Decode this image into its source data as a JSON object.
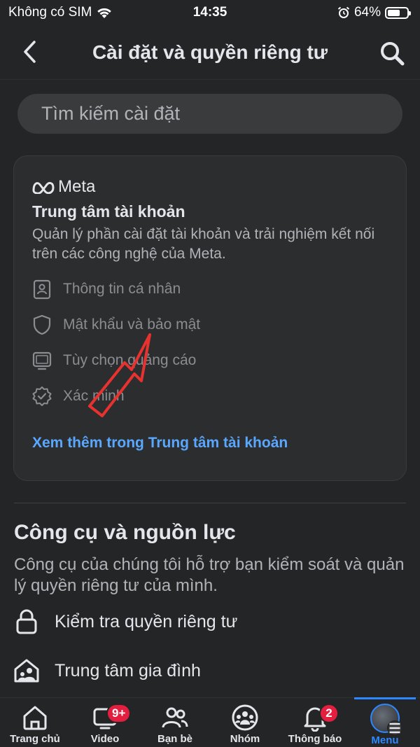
{
  "status": {
    "carrier": "Không có SIM",
    "time": "14:35",
    "battery": "64%",
    "battery_level": 0.64
  },
  "nav": {
    "title": "Cài đặt và quyền riêng tư"
  },
  "search": {
    "placeholder": "Tìm kiếm cài đặt"
  },
  "accounts_center": {
    "brand": "Meta",
    "title": "Trung tâm tài khoản",
    "description": "Quản lý phần cài đặt tài khoản và trải nghiệm kết nối trên các công nghệ của Meta.",
    "items": [
      {
        "label": "Thông tin cá nhân",
        "icon": "id-card-icon"
      },
      {
        "label": "Mật khẩu và bảo mật",
        "icon": "shield-icon"
      },
      {
        "label": "Tùy chọn quảng cáo",
        "icon": "monitor-icon"
      },
      {
        "label": "Xác minh",
        "icon": "verified-badge-icon"
      }
    ],
    "link": "Xem thêm trong Trung tâm tài khoản"
  },
  "tools": {
    "title": "Công cụ và nguồn lực",
    "description": "Công cụ của chúng tôi hỗ trợ bạn kiểm soát và quản lý quyền riêng tư của mình.",
    "items": [
      {
        "label": "Kiểm tra quyền riêng tư",
        "icon": "lock-icon"
      },
      {
        "label": "Trung tâm gia đình",
        "icon": "family-home-icon"
      }
    ]
  },
  "tabbar": {
    "tabs": [
      {
        "label": "Trang chủ",
        "icon": "home-icon"
      },
      {
        "label": "Video",
        "icon": "video-icon",
        "badge": "9+"
      },
      {
        "label": "Bạn bè",
        "icon": "friends-icon"
      },
      {
        "label": "Nhóm",
        "icon": "groups-icon"
      },
      {
        "label": "Thông báo",
        "icon": "bell-icon",
        "badge": "2"
      },
      {
        "label": "Menu",
        "icon": "avatar-menu-icon",
        "active": true
      }
    ]
  },
  "colors": {
    "background": "#242526",
    "accent": "#2d88ff",
    "link": "#5aa7ff",
    "badge": "#e41e3f",
    "annotation_arrow": "#e8322f"
  }
}
